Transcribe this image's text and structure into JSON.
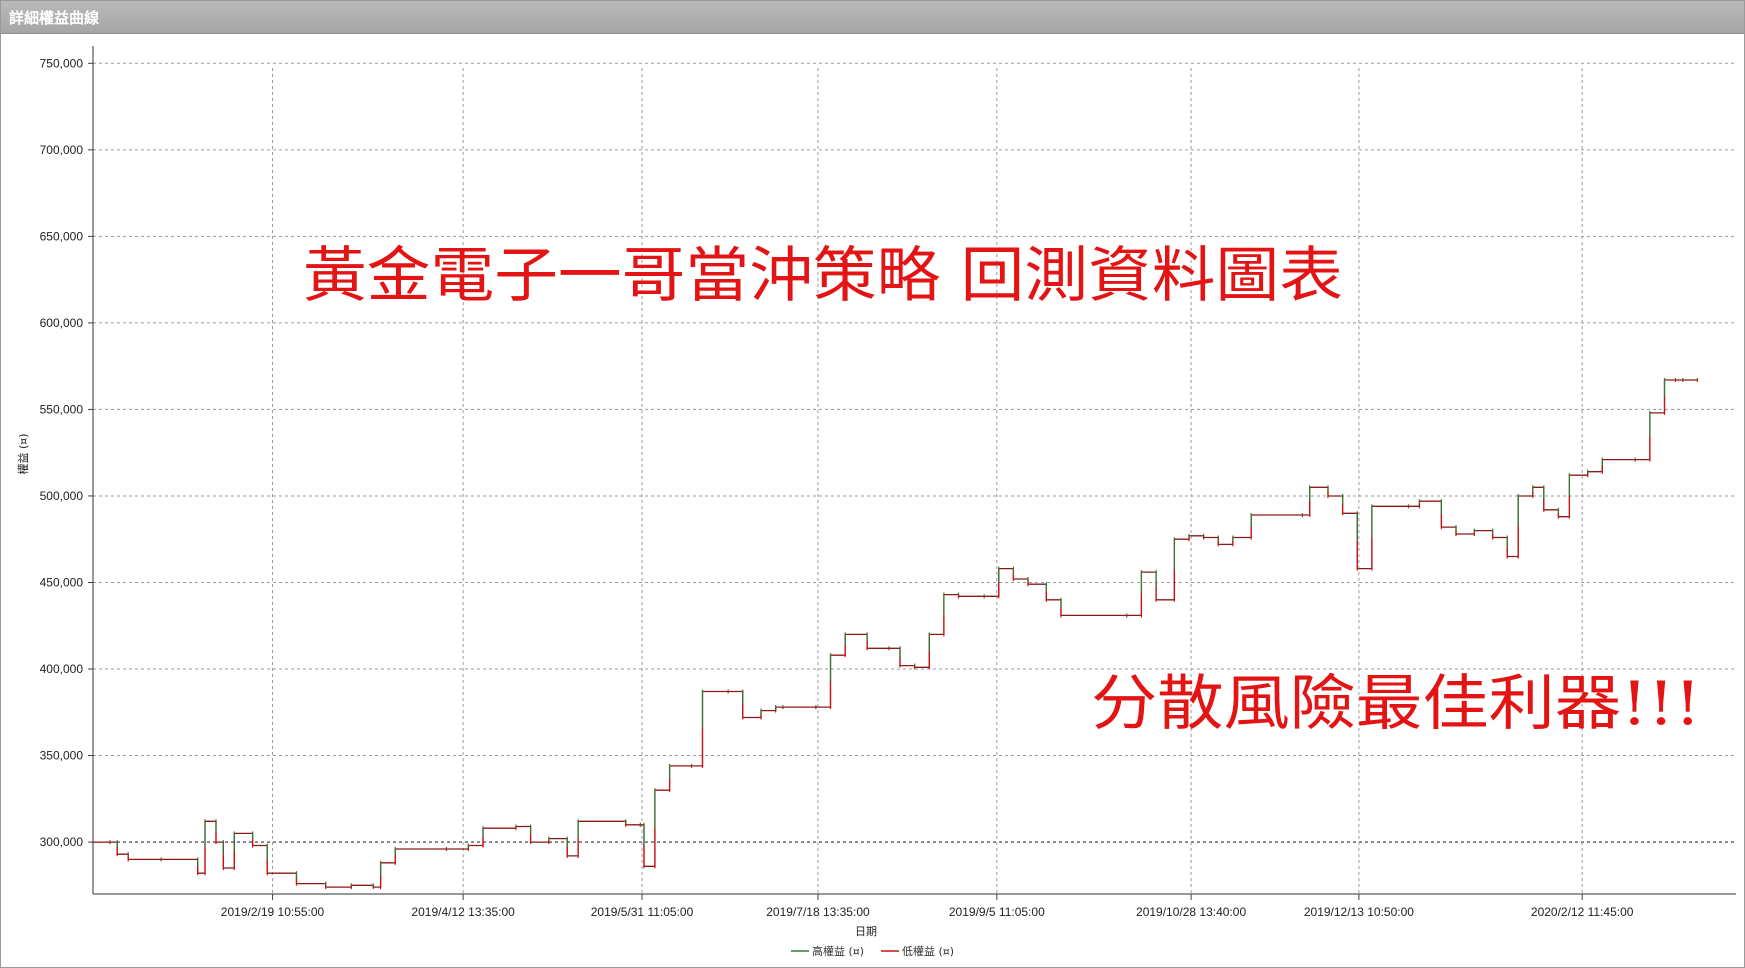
{
  "window": {
    "title": "詳細權益曲線"
  },
  "chart_data": {
    "type": "line",
    "ylabel": "權益 (¤)",
    "xlabel": "日期",
    "ylim": [
      270000,
      760000
    ],
    "y_ticks": [
      300000,
      350000,
      400000,
      450000,
      500000,
      550000,
      600000,
      650000,
      700000,
      750000
    ],
    "y_tick_labels": [
      "300,000",
      "350,000",
      "400,000",
      "450,000",
      "500,000",
      "550,000",
      "600,000",
      "650,000",
      "700,000",
      "750,000"
    ],
    "x_tick_labels": [
      "2019/2/19 10:55:00",
      "2019/4/12 13:35:00",
      "2019/5/31 11:05:00",
      "2019/7/18 13:35:00",
      "2019/9/5 11:05:00",
      "2019/10/28 13:40:00",
      "2019/12/13 10:50:00",
      "2020/2/12 11:45:00"
    ],
    "x_tick_dates": [
      "2019-02-19T10:55",
      "2019-04-12T13:35",
      "2019-05-31T11:05",
      "2019-07-18T13:35",
      "2019-09-05T11:05",
      "2019-10-28T13:40",
      "2019-12-13T10:50",
      "2020-02-12T11:45"
    ],
    "xlim": [
      "2019-01-01T09:00",
      "2020-03-25T13:00"
    ],
    "reference_line": 300000,
    "grid": true,
    "legend": "bottom-center",
    "series": [
      {
        "name": "高權益 (¤)",
        "color": "#2e7d32"
      },
      {
        "name": "低權益 (¤)",
        "color": "#cc1111"
      }
    ],
    "equity": [
      [
        "2019-01-01",
        300000
      ],
      [
        "2019-01-06",
        300000
      ],
      [
        "2019-01-08",
        293000
      ],
      [
        "2019-01-11",
        290000
      ],
      [
        "2019-01-20",
        290000
      ],
      [
        "2019-01-30",
        282000
      ],
      [
        "2019-02-01",
        312000
      ],
      [
        "2019-02-04",
        300000
      ],
      [
        "2019-02-06",
        285000
      ],
      [
        "2019-02-09",
        305000
      ],
      [
        "2019-02-14",
        298000
      ],
      [
        "2019-02-18",
        282000
      ],
      [
        "2019-02-26",
        276000
      ],
      [
        "2019-03-06",
        274000
      ],
      [
        "2019-03-13",
        275000
      ],
      [
        "2019-03-19",
        274000
      ],
      [
        "2019-03-21",
        288000
      ],
      [
        "2019-03-25",
        296000
      ],
      [
        "2019-04-08",
        296000
      ],
      [
        "2019-04-14",
        298000
      ],
      [
        "2019-04-18",
        308000
      ],
      [
        "2019-04-27",
        309000
      ],
      [
        "2019-05-01",
        300000
      ],
      [
        "2019-05-06",
        302000
      ],
      [
        "2019-05-11",
        292000
      ],
      [
        "2019-05-14",
        312000
      ],
      [
        "2019-05-27",
        310000
      ],
      [
        "2019-05-31",
        310000
      ],
      [
        "2019-06-01",
        286000
      ],
      [
        "2019-06-04",
        330000
      ],
      [
        "2019-06-08",
        344000
      ],
      [
        "2019-06-14",
        344000
      ],
      [
        "2019-06-17",
        387000
      ],
      [
        "2019-06-24",
        387000
      ],
      [
        "2019-06-28",
        372000
      ],
      [
        "2019-07-03",
        376000
      ],
      [
        "2019-07-07",
        378000
      ],
      [
        "2019-07-09",
        378000
      ],
      [
        "2019-07-18",
        378000
      ],
      [
        "2019-07-22",
        408000
      ],
      [
        "2019-07-26",
        420000
      ],
      [
        "2019-08-01",
        412000
      ],
      [
        "2019-08-07",
        412000
      ],
      [
        "2019-08-10",
        402000
      ],
      [
        "2019-08-14",
        401000
      ],
      [
        "2019-08-18",
        420000
      ],
      [
        "2019-08-22",
        443000
      ],
      [
        "2019-08-26",
        442000
      ],
      [
        "2019-09-02",
        442000
      ],
      [
        "2019-09-06",
        458000
      ],
      [
        "2019-09-10",
        452000
      ],
      [
        "2019-09-14",
        449000
      ],
      [
        "2019-09-19",
        440000
      ],
      [
        "2019-09-23",
        431000
      ],
      [
        "2019-10-11",
        431000
      ],
      [
        "2019-10-15",
        456000
      ],
      [
        "2019-10-19",
        440000
      ],
      [
        "2019-10-24",
        475000
      ],
      [
        "2019-10-28",
        477000
      ],
      [
        "2019-11-01",
        476000
      ],
      [
        "2019-11-05",
        472000
      ],
      [
        "2019-11-09",
        476000
      ],
      [
        "2019-11-14",
        489000
      ],
      [
        "2019-11-28",
        489000
      ],
      [
        "2019-11-30",
        505000
      ],
      [
        "2019-12-05",
        500000
      ],
      [
        "2019-12-09",
        490000
      ],
      [
        "2019-12-13",
        458000
      ],
      [
        "2019-12-17",
        494000
      ],
      [
        "2019-12-27",
        494000
      ],
      [
        "2019-12-30",
        497000
      ],
      [
        "2020-01-05",
        482000
      ],
      [
        "2020-01-09",
        478000
      ],
      [
        "2020-01-14",
        480000
      ],
      [
        "2020-01-19",
        476000
      ],
      [
        "2020-01-23",
        465000
      ],
      [
        "2020-01-26",
        500000
      ],
      [
        "2020-01-30",
        505000
      ],
      [
        "2020-02-02",
        492000
      ],
      [
        "2020-02-06",
        488000
      ],
      [
        "2020-02-09",
        512000
      ],
      [
        "2020-02-14",
        514000
      ],
      [
        "2020-02-18",
        521000
      ],
      [
        "2020-02-27",
        521000
      ],
      [
        "2020-03-02",
        548000
      ],
      [
        "2020-03-06",
        567000
      ],
      [
        "2020-03-09",
        567000
      ],
      [
        "2020-03-11",
        567000
      ],
      [
        "2020-03-15",
        567000
      ]
    ]
  },
  "overlay": {
    "headline": "黃金電子一哥當沖策略 回測資料圖表",
    "tagline": "分散風險最佳利器!!!"
  }
}
